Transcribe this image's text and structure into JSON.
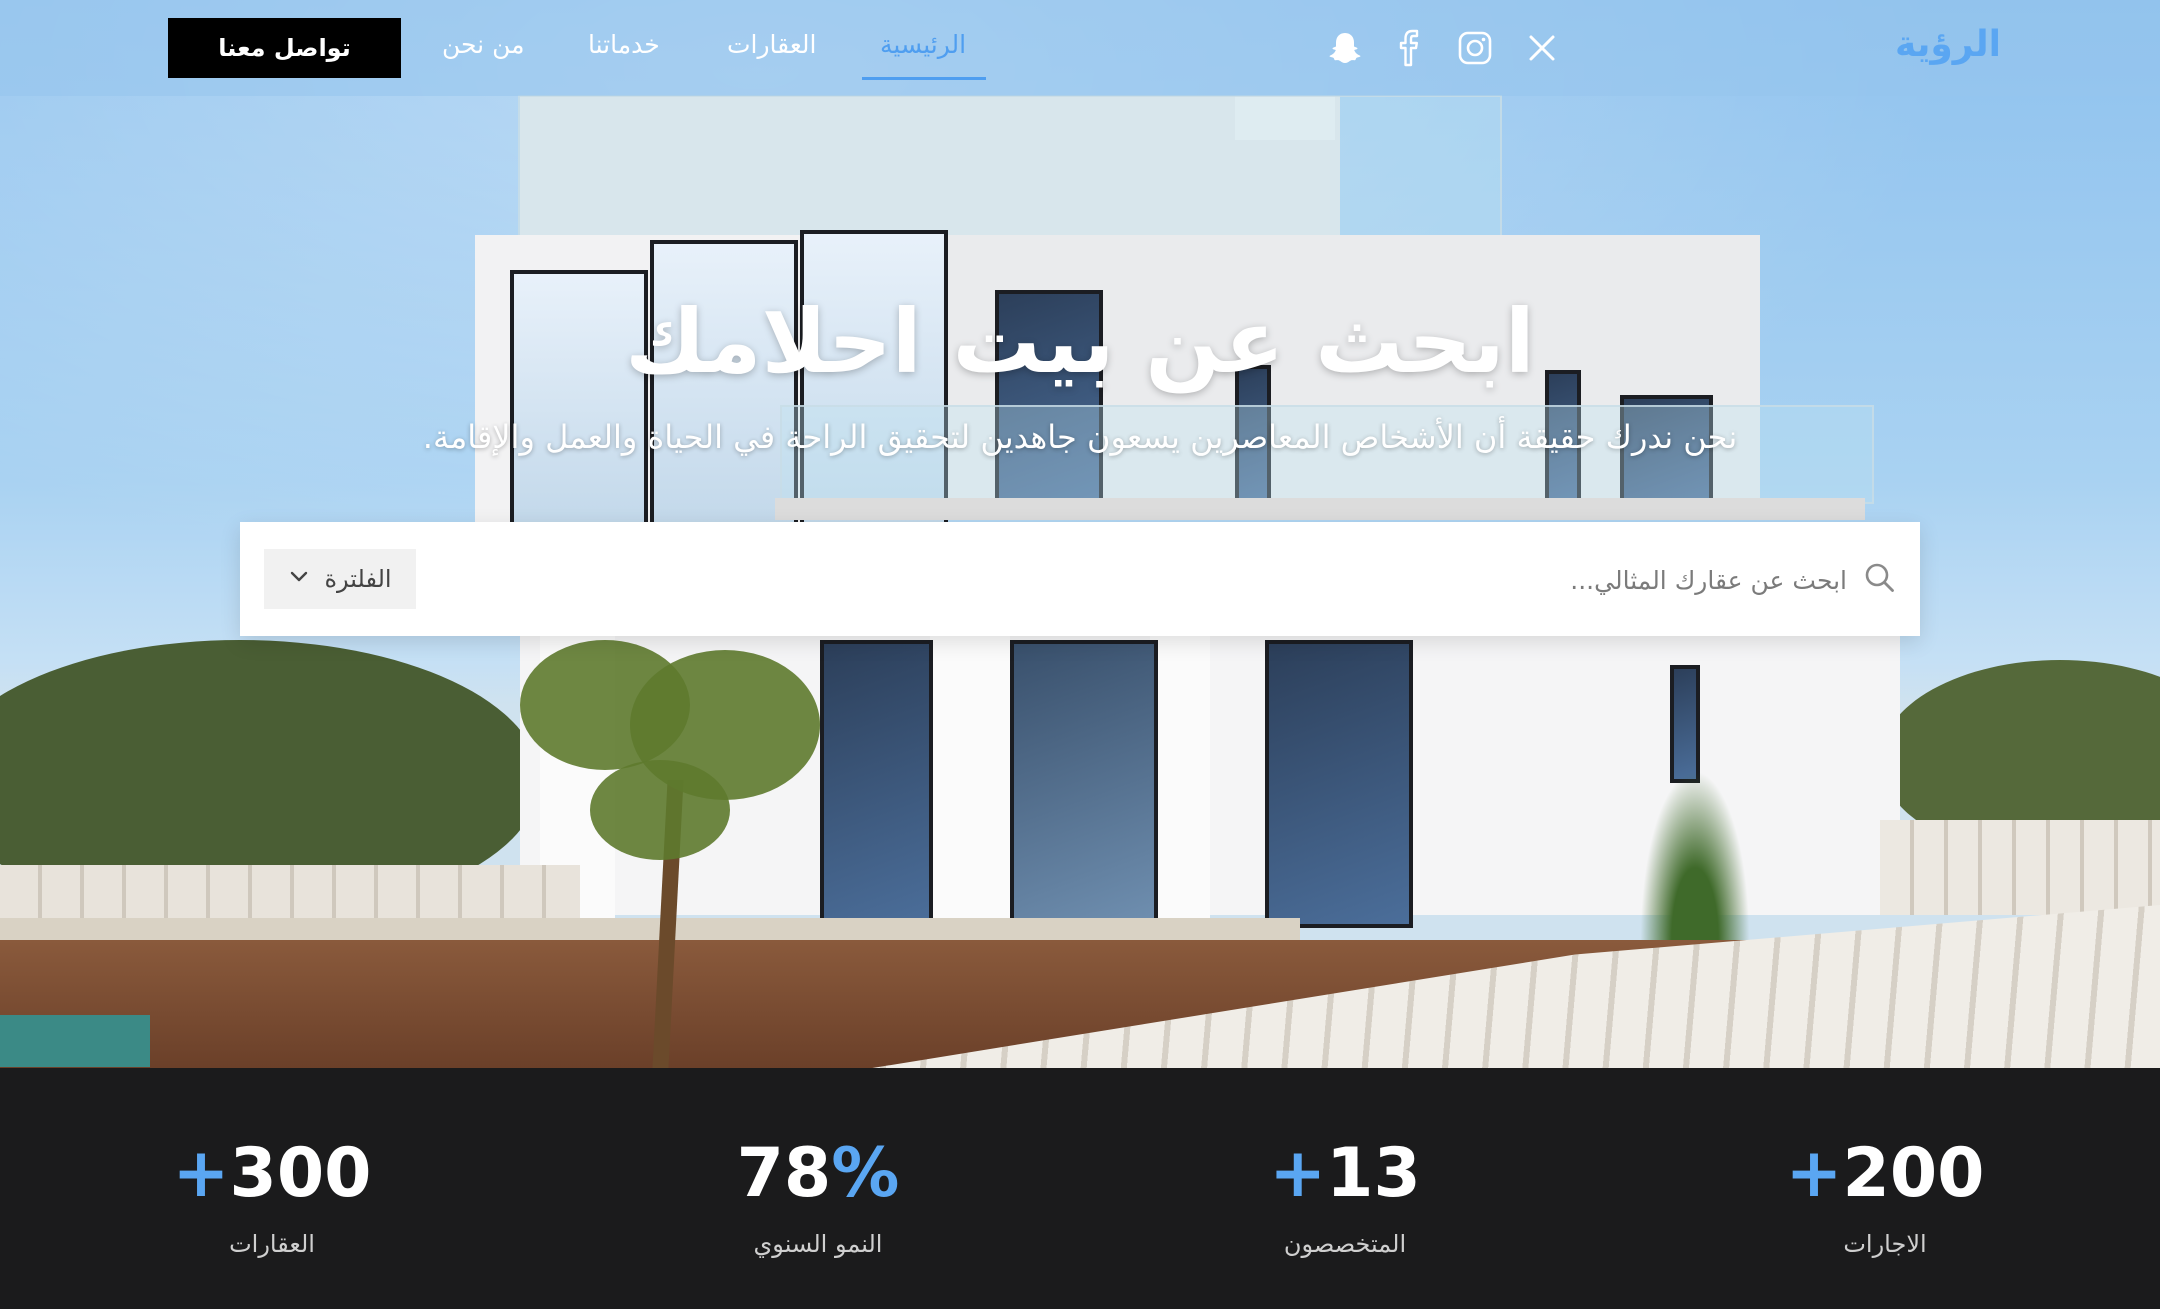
{
  "nav": {
    "logo": "الرؤية",
    "links": [
      "الرئيسية",
      "العقارات",
      "خدماتنا",
      "من نحن"
    ],
    "active_link": "الرئيسية",
    "cta": "تواصل معنا",
    "social_icons": [
      "snapchat-icon",
      "facebook-icon",
      "instagram-icon",
      "x-icon"
    ]
  },
  "hero": {
    "title": "ابحث عن بيت احلامك",
    "subtitle": "نحن ندرك حقيقة أن الأشخاص المعاصرين يسعون جاهدين لتحقيق الراحة في الحياة والعمل والإقامة."
  },
  "search": {
    "placeholder": "ابحث عن عقارك المثالي...",
    "filter_label": "الفلترة"
  },
  "stats": [
    {
      "value": "200",
      "accent": "+",
      "label": "الاجارات"
    },
    {
      "value": "13",
      "accent": "+",
      "label": "المتخصصون"
    },
    {
      "value": "78",
      "accent": "%",
      "label": "النمو السنوي"
    },
    {
      "value": "300",
      "accent": "+",
      "label": "العقارات"
    }
  ],
  "colors": {
    "accent": "#4f9ef0",
    "stats_background": "#1b1b1c",
    "cta_background": "#000000"
  }
}
